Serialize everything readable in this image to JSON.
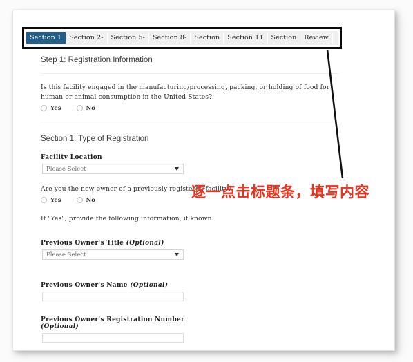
{
  "tabs": [
    {
      "label": "Section 1",
      "active": true
    },
    {
      "label": "Section 2-",
      "active": false
    },
    {
      "label": "Section 5-",
      "active": false
    },
    {
      "label": "Section 8-",
      "active": false
    },
    {
      "label": "Section",
      "active": false
    },
    {
      "label": "Section 11",
      "active": false
    },
    {
      "label": "Section",
      "active": false
    },
    {
      "label": "Review",
      "active": false
    }
  ],
  "form": {
    "step_title": "Step 1: Registration Information",
    "question_1": "Is this facility engaged in the manufacturing/processing, packing, or holding of food for human or animal consumption in the United States?",
    "question_1_options": [
      "Yes",
      "No"
    ],
    "section_heading": "Section 1: Type of Registration",
    "facility_location_label": "Facility Location",
    "facility_location_value": "Please Select",
    "question_2": "Are you the new owner of a previously registered facility?",
    "question_2_options": [
      "Yes",
      "No"
    ],
    "note": "If \"Yes\", provide the following information, if known.",
    "prev_owner_title_label": "Previous Owner's Title",
    "prev_owner_title_optional": "(Optional)",
    "prev_owner_title_value": "Please Select",
    "prev_owner_name_label": "Previous Owner's Name",
    "prev_owner_name_optional": "(Optional)",
    "prev_owner_name_value": "",
    "prev_owner_regnum_label": "Previous Owner's Registration Number",
    "prev_owner_regnum_optional": "(Optional)",
    "prev_owner_regnum_value": ""
  },
  "annotation": {
    "text": "逐一点击标题条，填写内容",
    "color": "#e8331e"
  },
  "colors": {
    "active_tab_background": "#1f5f8b",
    "tab_background": "#f0f0f0",
    "highlight_border": "#0b0b0b",
    "page_background": "#ffffff"
  }
}
